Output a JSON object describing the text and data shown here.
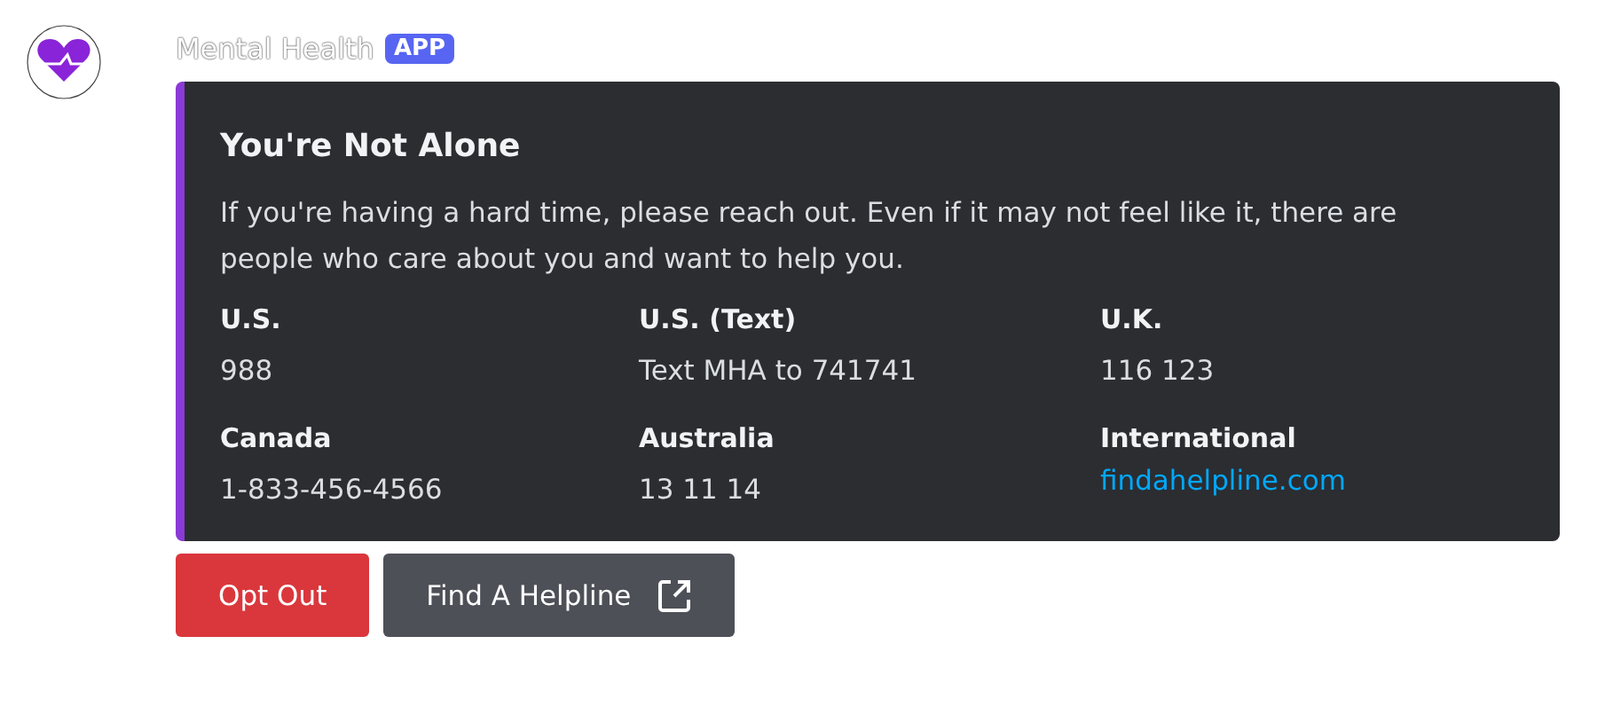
{
  "author": {
    "name": "Mental Health",
    "badge": "APP"
  },
  "embed": {
    "title": "You're Not Alone",
    "description": "If you're having a hard time, please reach out. Even if it may not feel like it, there are people who care about you and want to help you.",
    "fields": [
      {
        "name": "U.S.",
        "value": "988",
        "kind": "text"
      },
      {
        "name": "U.S. (Text)",
        "value": "Text MHA to 741741",
        "kind": "text"
      },
      {
        "name": "U.K.",
        "value": "116 123",
        "kind": "text"
      },
      {
        "name": "Canada",
        "value": "1-833-456-4566",
        "kind": "text"
      },
      {
        "name": "Australia",
        "value": "13 11 14",
        "kind": "text"
      },
      {
        "name": "International",
        "value": "findahelpline.com",
        "kind": "link"
      }
    ]
  },
  "buttons": [
    {
      "label": "Opt Out",
      "kind": "danger"
    },
    {
      "label": "Find A Helpline",
      "kind": "external"
    }
  ]
}
